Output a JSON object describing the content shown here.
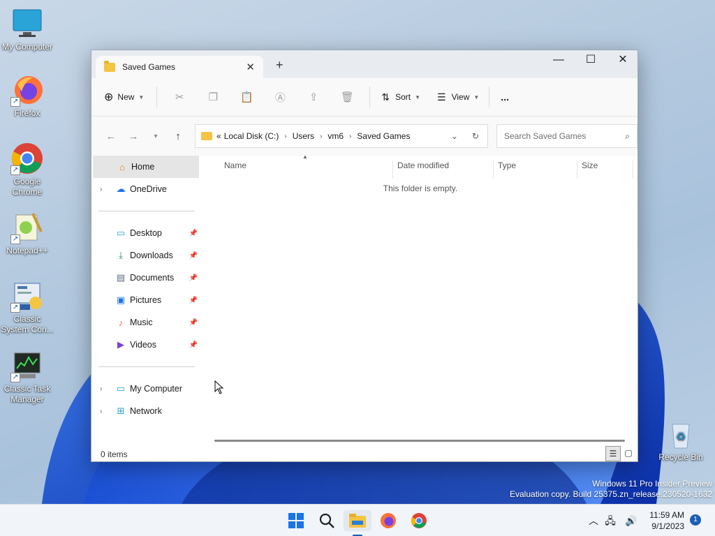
{
  "desktop": {
    "icons": [
      {
        "label": "My Computer",
        "icon": "monitor-icon"
      },
      {
        "label": "Firefox",
        "icon": "firefox-icon"
      },
      {
        "label": "Google Chrome",
        "icon": "chrome-icon"
      },
      {
        "label": "Notepad++",
        "icon": "notepadpp-icon"
      },
      {
        "label": "Classic System Con...",
        "icon": "control-panel-icon"
      },
      {
        "label": "Classic Task Manager",
        "icon": "task-manager-icon"
      },
      {
        "label": "Recycle Bin",
        "icon": "recycle-bin-icon"
      }
    ],
    "watermark_line1": "Windows 11 Pro Insider Preview",
    "watermark_line2": "Evaluation copy. Build 25375.zn_release.230520-1632"
  },
  "window": {
    "tab_title": "Saved Games",
    "new_tab": "+",
    "toolbar": {
      "new_label": "New",
      "sort_label": "Sort",
      "view_label": "View",
      "more_label": "..."
    },
    "address": {
      "overflow": "«",
      "crumbs": [
        "Local Disk (C:)",
        "Users",
        "vm6",
        "Saved Games"
      ]
    },
    "search": {
      "placeholder": "Search Saved Games"
    },
    "nav": {
      "home": "Home",
      "onedrive": "OneDrive",
      "quick": [
        "Desktop",
        "Downloads",
        "Documents",
        "Pictures",
        "Music",
        "Videos"
      ],
      "my_computer": "My Computer",
      "network": "Network"
    },
    "columns": [
      "Name",
      "Date modified",
      "Type",
      "Size"
    ],
    "empty_message": "This folder is empty.",
    "status": "0 items"
  },
  "taskbar": {
    "time": "11:59 AM",
    "date": "9/1/2023",
    "notification_count": "1"
  },
  "colors": {
    "accent": "#1a5fb4",
    "folder": "#f4c542"
  }
}
